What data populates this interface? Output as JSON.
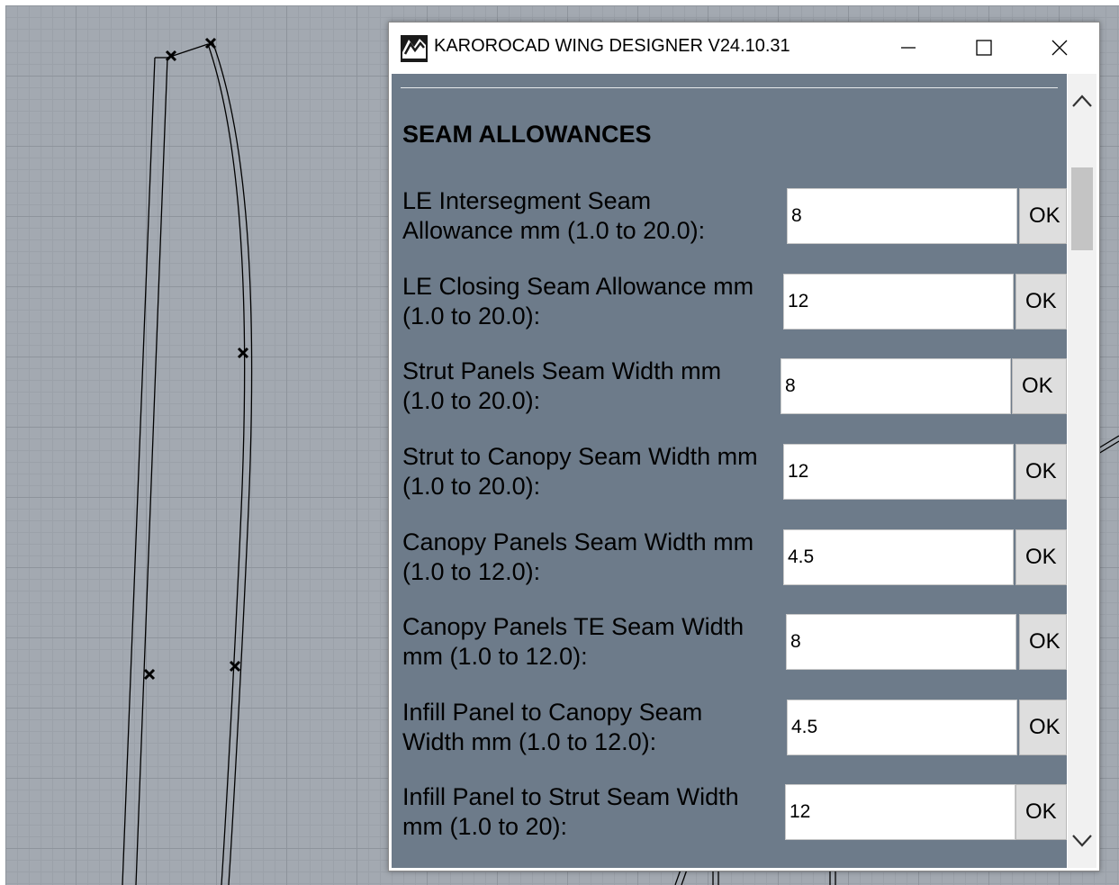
{
  "window": {
    "title": "KAROROCAD WING DESIGNER V24.10.31",
    "icon": "karorocad-logo-icon",
    "controls": [
      "minimize-icon",
      "maximize-icon",
      "close-icon"
    ]
  },
  "section": {
    "title": "SEAM ALLOWANCES"
  },
  "rows": [
    {
      "label_line1": "LE Intersegment Seam",
      "label_line2": "Allowance mm (1.0 to 20.0):",
      "value": "8",
      "ok": "OK"
    },
    {
      "label_line1": "LE Closing Seam Allowance mm",
      "label_line2": "(1.0 to 20.0):",
      "value": "12",
      "ok": "OK"
    },
    {
      "label_line1": "Strut Panels Seam Width mm",
      "label_line2": "(1.0 to 20.0):",
      "value": "8",
      "ok": "OK"
    },
    {
      "label_line1": "Strut to Canopy Seam Width mm",
      "label_line2": "(1.0 to 20.0):",
      "value": "12",
      "ok": "OK"
    },
    {
      "label_line1": "Canopy Panels Seam Width mm",
      "label_line2": "(1.0 to 12.0):",
      "value": "4.5",
      "ok": "OK"
    },
    {
      "label_line1": "Canopy Panels TE Seam Width",
      "label_line2": "mm (1.0 to 12.0):",
      "value": "8",
      "ok": "OK"
    },
    {
      "label_line1": "Infill Panel to Canopy Seam",
      "label_line2": "Width mm (1.0 to 12.0):",
      "value": "4.5",
      "ok": "OK"
    },
    {
      "label_line1": "Infill Panel to Strut Seam Width",
      "label_line2": "mm (1.0 to 20):",
      "value": "12",
      "ok": "OK"
    }
  ],
  "scrollbar": {
    "up": "chevron-up-icon",
    "down": "chevron-down-icon"
  }
}
